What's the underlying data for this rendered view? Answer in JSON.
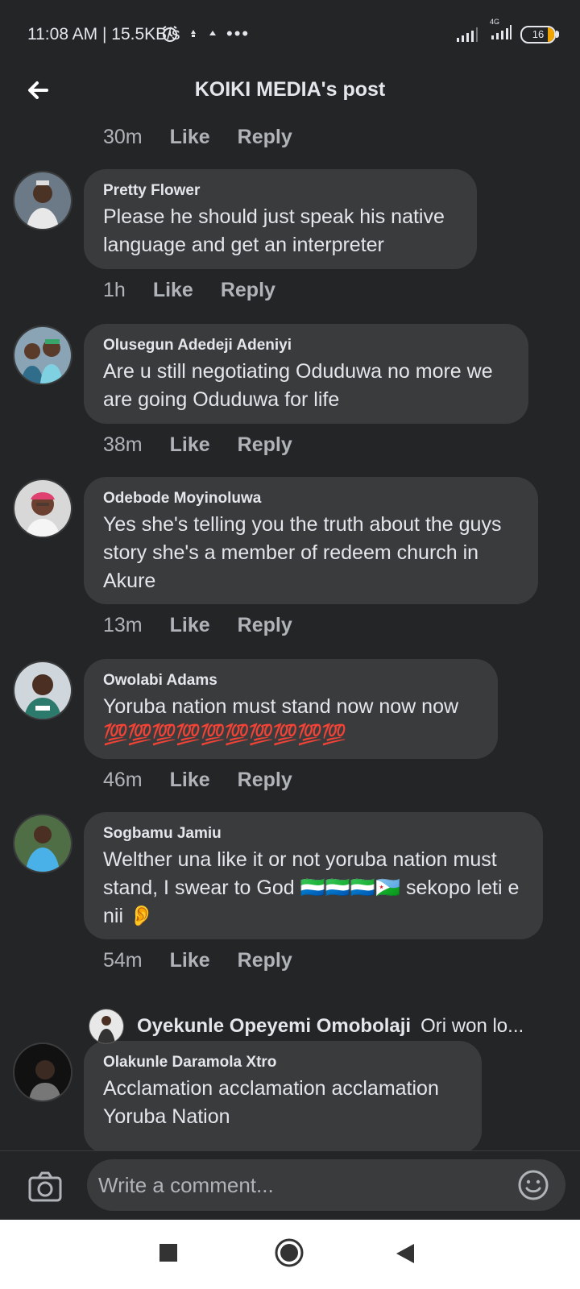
{
  "status_bar": {
    "time": "11:08 AM | 15.5KB/s",
    "battery": "16",
    "network": "4G"
  },
  "header": {
    "title": "KOIKI MEDIA's post"
  },
  "top_actions": {
    "time": "30m",
    "like": "Like",
    "reply": "Reply"
  },
  "comments": [
    {
      "author": "Pretty Flower",
      "text": "Please he should just speak his native language and get an interpreter",
      "time": "1h",
      "like": "Like",
      "reply": "Reply"
    },
    {
      "author": "Olusegun Adedeji Adeniyi",
      "text": "Are u still negotiating Oduduwa no more we are going Oduduwa for life",
      "time": "38m",
      "like": "Like",
      "reply": "Reply"
    },
    {
      "author": "Odebode Moyinoluwa",
      "text": "Yes she's telling you the truth about the guys story she's a member of redeem  church in Akure",
      "time": "13m",
      "like": "Like",
      "reply": "Reply"
    },
    {
      "author": "Owolabi Adams",
      "text": "Yoruba nation must stand now now now",
      "emoji": "💯💯💯💯💯💯💯💯💯💯",
      "time": "46m",
      "like": "Like",
      "reply": "Reply"
    },
    {
      "author": "Sogbamu Jamiu",
      "text": "Welther una like it or not yoruba nation must stand, I swear to God 🇸🇱🇸🇱🇸🇱🇩🇯 sekopo leti e nii 👂",
      "time": "54m",
      "like": "Like",
      "reply": "Reply"
    },
    {
      "author": "Olakunle Daramola Xtro",
      "text": "Acclamation acclamation acclamation Yoruba Nation"
    }
  ],
  "reply_preview": {
    "author": "Oyekunle Opeyemi Omobolaji",
    "snippet": "Ori won lo..."
  },
  "composer": {
    "placeholder": "Write a comment..."
  },
  "colors": {
    "background": "#242527",
    "bubble": "#3a3b3c",
    "text": "#e4e6eb",
    "secondary_text": "#b0b3b8"
  },
  "icons": [
    "back-arrow-icon",
    "camera-icon",
    "emoji-smile-icon",
    "nav-square-icon",
    "nav-home-icon",
    "nav-back-icon",
    "alarm-icon",
    "signal-icon",
    "battery-icon"
  ]
}
